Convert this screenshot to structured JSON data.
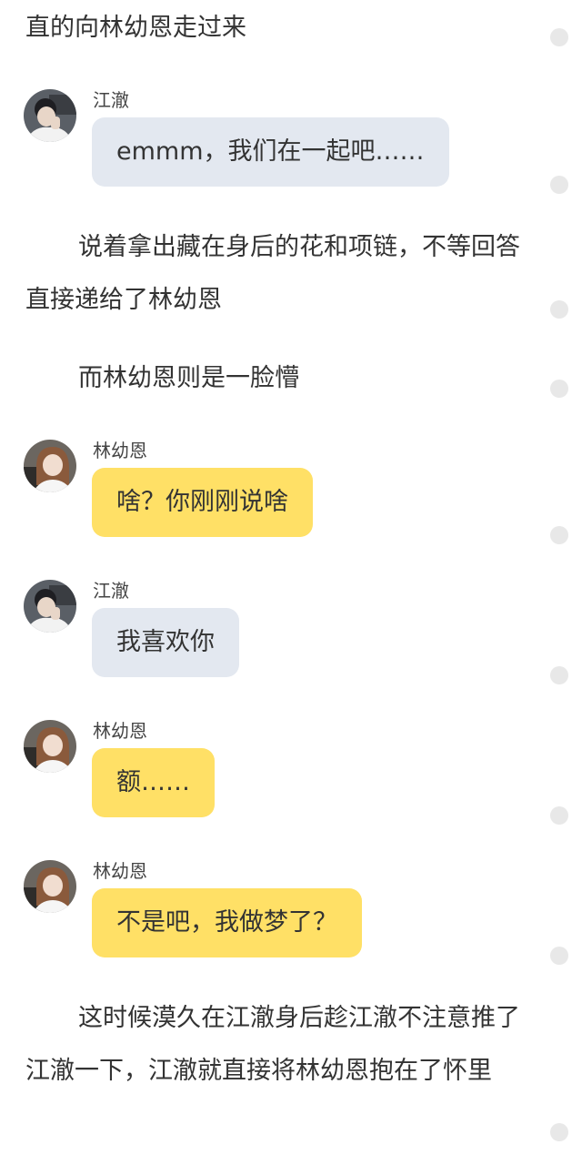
{
  "story": {
    "p1": "直的向林幼恩走过来",
    "p2": "说着拿出藏在身后的花和项链，不等回答直接递给了林幼恩",
    "p3": "而林幼恩则是一脸懵",
    "p4": "这时候漠久在江澈身后趁江澈不注意推了江澈一下，江澈就直接将林幼恩抱在了怀里"
  },
  "chat": [
    {
      "speaker": "江澈",
      "text": "emmm，我们在一起吧……",
      "bubble_color": "#e3e8f0",
      "avatar": "male-avatar"
    },
    {
      "speaker": "林幼恩",
      "text": "啥？你刚刚说啥",
      "bubble_color": "#ffe066",
      "avatar": "female-avatar"
    },
    {
      "speaker": "江澈",
      "text": "我喜欢你",
      "bubble_color": "#e3e8f0",
      "avatar": "male-avatar"
    },
    {
      "speaker": "林幼恩",
      "text": "额……",
      "bubble_color": "#ffe066",
      "avatar": "female-avatar"
    },
    {
      "speaker": "林幼恩",
      "text": "不是吧，我做梦了？",
      "bubble_color": "#ffe066",
      "avatar": "female-avatar"
    }
  ]
}
